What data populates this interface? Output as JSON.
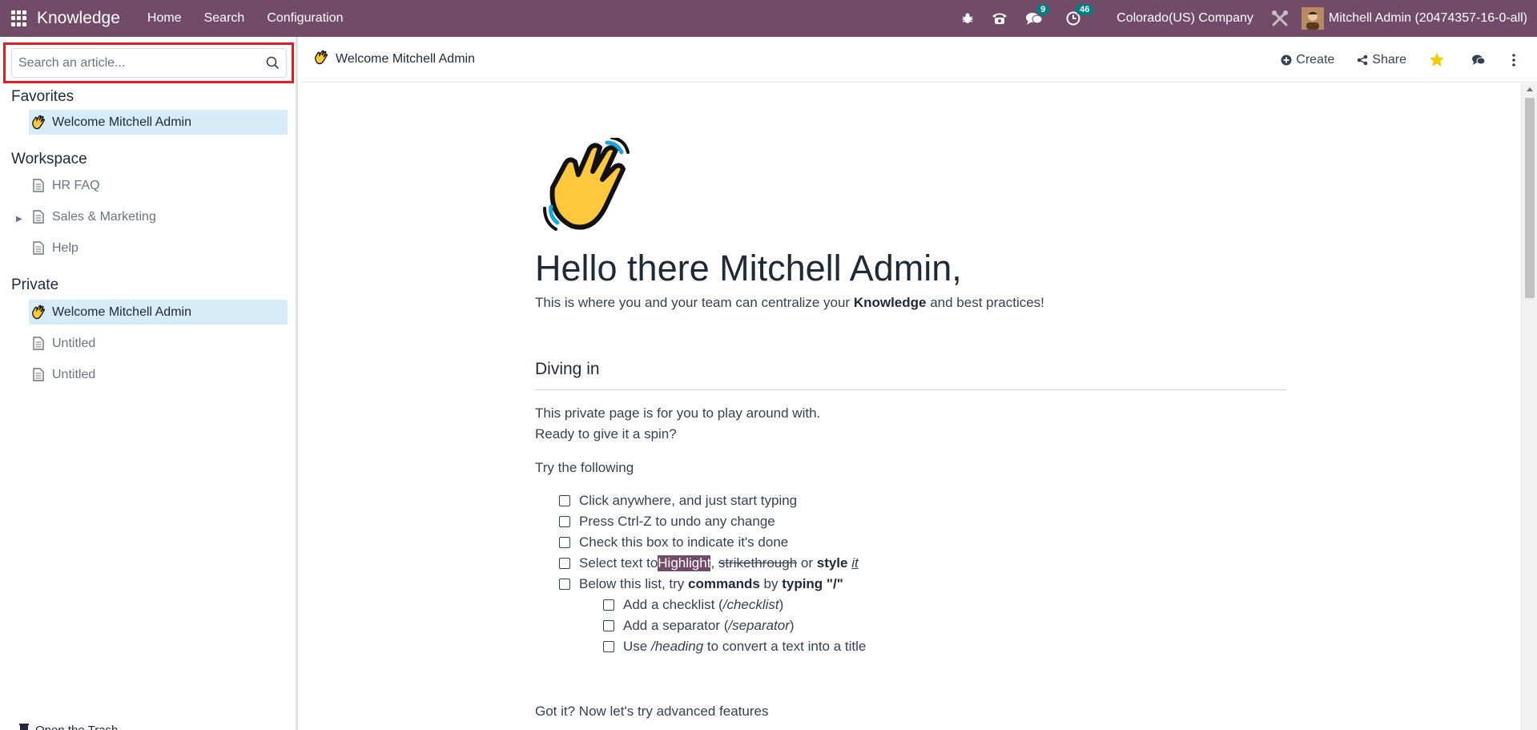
{
  "navbar": {
    "brand": "Knowledge",
    "menus": [
      "Home",
      "Search",
      "Configuration"
    ],
    "messages_badge": "9",
    "activities_badge": "46",
    "company": "Colorado(US) Company",
    "user": "Mitchell Admin (20474357-16-0-all)",
    "bg_color": "#714B67"
  },
  "sidebar": {
    "search_placeholder": "Search an article...",
    "favorites_title": "Favorites",
    "favorites": [
      {
        "label": "Welcome Mitchell Admin",
        "icon": "waving-hand-icon",
        "active": true
      }
    ],
    "workspace_title": "Workspace",
    "workspace": [
      {
        "label": "HR FAQ",
        "icon": "document-icon"
      },
      {
        "label": "Sales & Marketing",
        "icon": "document-icon",
        "expandable": true
      },
      {
        "label": "Help",
        "icon": "document-icon"
      }
    ],
    "private_title": "Private",
    "private": [
      {
        "label": "Welcome Mitchell Admin",
        "icon": "waving-hand-icon",
        "active": true
      },
      {
        "label": "Untitled",
        "icon": "document-icon"
      },
      {
        "label": "Untitled",
        "icon": "document-icon"
      }
    ],
    "trash_label": "Open the Trash"
  },
  "header": {
    "breadcrumb": "Welcome Mitchell Admin",
    "create_label": "Create",
    "share_label": "Share",
    "star_color": "#f3cc00"
  },
  "article": {
    "title": "Hello there Mitchell Admin,",
    "intro_pre": "This is where you and your team can centralize your ",
    "intro_bold": "Knowledge",
    "intro_post": " and best practices!",
    "section_heading": "Diving in",
    "para1": "This private page is for you to play around with.",
    "para2": "Ready to give it a spin?",
    "para3": "Try the following",
    "checklist": {
      "item1": "Click anywhere, and just start typing",
      "item2": "Press Ctrl-Z to undo any change",
      "item3": "Check this box to indicate it's done",
      "item4_pre": "Select text to ",
      "item4_highlight": "Highlight",
      "item4_comma": ", ",
      "item4_strike": "strikethrough",
      "item4_or": " or ",
      "item4_style": "style",
      "item4_it": "it",
      "item5_pre": "Below this list, try ",
      "item5_commands": "commands",
      "item5_by": " by ",
      "item5_typing": "typing",
      "item5_slash": " \"/\"",
      "sub1_pre": "Add a checklist (",
      "sub1_cmd": "/checklist",
      "sub1_post": ")",
      "sub2_pre": "Add a separator (",
      "sub2_cmd": "/separator",
      "sub2_post": ")",
      "sub3_pre": "Use ",
      "sub3_cmd": "/heading",
      "sub3_post": " to convert a text into a title"
    },
    "para4": "Got it? Now let's try advanced features"
  }
}
